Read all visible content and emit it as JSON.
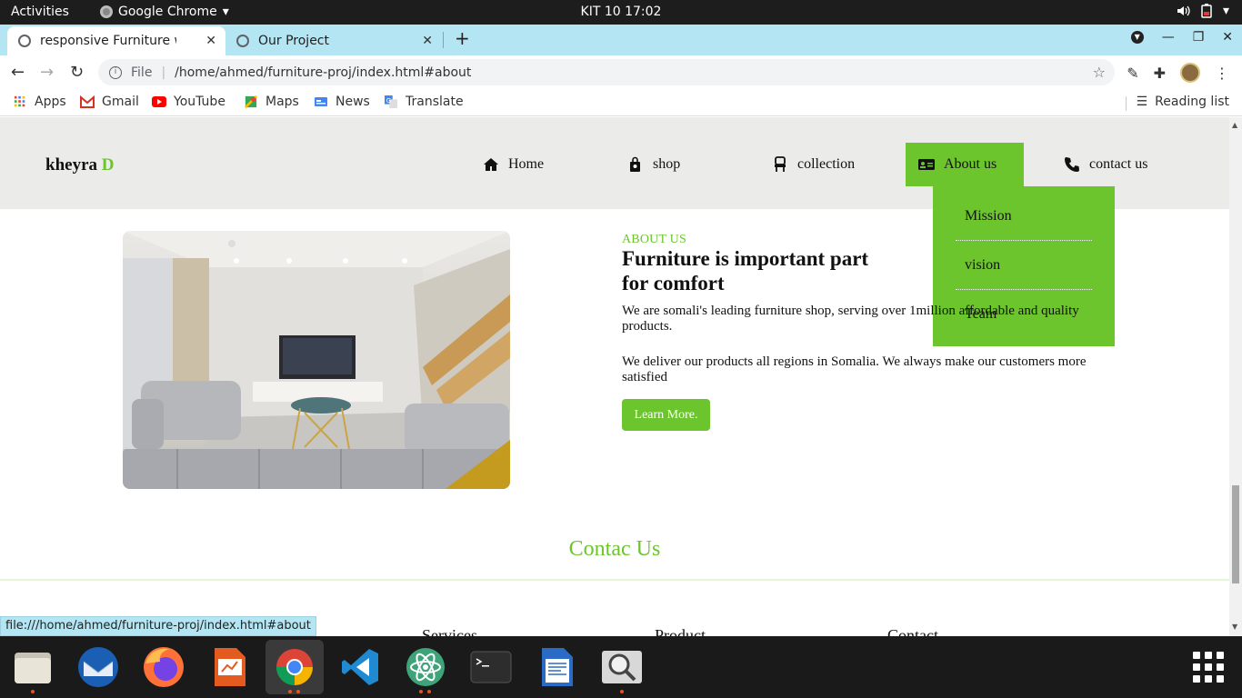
{
  "system": {
    "activities": "Activities",
    "app_name": "Google Chrome",
    "clock": "KIT 10  17:02"
  },
  "browser": {
    "tabs": [
      {
        "title": "responsive Furniture web",
        "active": true
      },
      {
        "title": "Our Project",
        "active": false
      }
    ],
    "url_scheme": "File",
    "url": "/home/ahmed/furniture-proj/index.html#about",
    "bookmarks": [
      "Apps",
      "Gmail",
      "YouTube",
      "Maps",
      "News",
      "Translate"
    ],
    "reading_list": "Reading list",
    "status_url": "file:///home/ahmed/furniture-proj/index.html#about"
  },
  "site": {
    "logo_main": "kheyra",
    "logo_accent": "D",
    "nav": [
      {
        "label": "Home",
        "icon": "home-icon"
      },
      {
        "label": "shop",
        "icon": "shopping-bag-icon"
      },
      {
        "label": "collection",
        "icon": "chair-icon"
      },
      {
        "label": "About us",
        "icon": "id-card-icon"
      },
      {
        "label": "contact us",
        "icon": "phone-icon"
      }
    ],
    "dropdown": [
      "Mission",
      "vision",
      "Team"
    ],
    "about": {
      "eyebrow": "ABOUT US",
      "title": "Furniture is important part for comfort",
      "p1": "We are somali's leading furniture shop, serving over 1million affordable and quality products.",
      "p2": "We deliver our products all regions in Somalia. We always make our customers more satisfied",
      "button": "Learn More."
    },
    "contact_title": "Contac Us",
    "footer_cols": [
      "Services",
      "Product",
      "Contact"
    ],
    "accent_color": "#6cc52d"
  },
  "dock": [
    "Files",
    "Thunderbird",
    "Firefox",
    "Impress",
    "Chrome",
    "VS Code",
    "Atom",
    "Terminal",
    "Writer",
    "Image Viewer"
  ]
}
